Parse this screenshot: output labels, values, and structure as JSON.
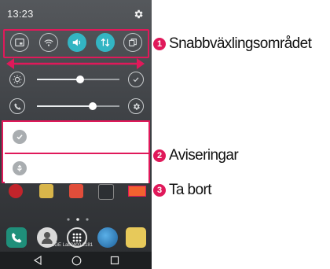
{
  "status_bar": {
    "time": "13:23",
    "settings_icon": "gear-icon"
  },
  "quick_settings": {
    "toggles": [
      {
        "name": "screen-capture-icon",
        "active": false
      },
      {
        "name": "wifi-icon",
        "active": false
      },
      {
        "name": "sound-icon",
        "active": true
      },
      {
        "name": "mobile-data-icon",
        "active": true
      },
      {
        "name": "copy-icon",
        "active": false
      }
    ],
    "brightness": {
      "level": 0.52,
      "end_icon": "check-circle-icon"
    },
    "volume": {
      "level": 0.68,
      "end_icon": "settings-icon"
    }
  },
  "notifications": [
    {
      "icon": "check-icon"
    },
    {
      "icon": "usb-icon"
    }
  ],
  "dock_label": "LGE Lab2400 2181",
  "callouts": [
    {
      "number": "1",
      "text": "Snabbväxlingsområdet"
    },
    {
      "number": "2",
      "text": "Aviseringar"
    },
    {
      "number": "3",
      "text": "Ta bort"
    }
  ],
  "colors": {
    "accent": "#33b5c3",
    "highlight": "#e0195a",
    "clear_button": "#f2622f"
  }
}
